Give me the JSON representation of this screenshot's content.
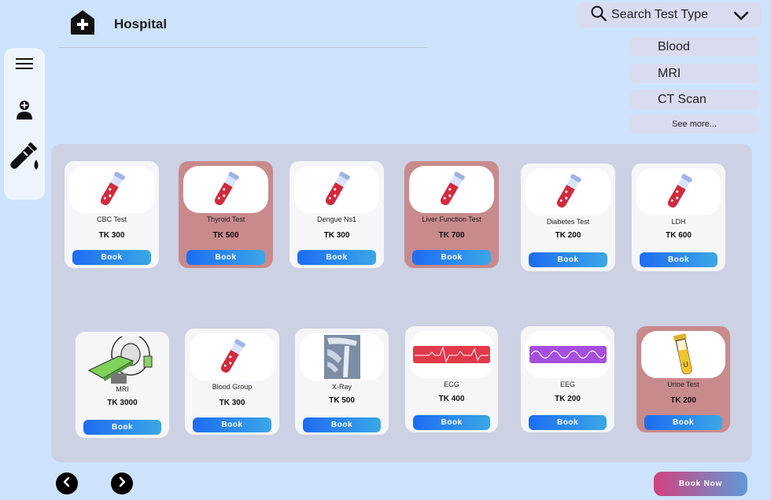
{
  "header": {
    "title": "Hospital"
  },
  "search": {
    "label": "Search Test Type",
    "options": [
      "Blood",
      "MRI",
      "CT Scan"
    ],
    "see_more": "See more..."
  },
  "tests": [
    {
      "name": "CBC Test",
      "price": "TK 300",
      "book": "Book",
      "icon": "test-tube-icon",
      "highlight": false
    },
    {
      "name": "Thyroid  Test",
      "price": "TK 500",
      "book": "Book",
      "icon": "test-tube-icon",
      "highlight": true
    },
    {
      "name": "Dengue Ns1",
      "price": "TK 300",
      "book": "Book",
      "icon": "test-tube-icon",
      "highlight": false
    },
    {
      "name": "Liver Function Test",
      "price": "TK 700",
      "book": "Book",
      "icon": "test-tube-icon",
      "highlight": true
    },
    {
      "name": "Diabetes Test",
      "price": "TK 200",
      "book": "Book",
      "icon": "test-tube-icon",
      "highlight": false
    },
    {
      "name": "LDH",
      "price": "TK 600",
      "book": "Book",
      "icon": "test-tube-icon",
      "highlight": false
    },
    {
      "name": "MRI",
      "price": "TK 3000",
      "book": "Book",
      "icon": "mri-machine-icon",
      "highlight": false
    },
    {
      "name": "Blood Group",
      "price": "TK 300",
      "book": "Book",
      "icon": "test-tube-icon",
      "highlight": false
    },
    {
      "name": "X-Ray",
      "price": "TK 500",
      "book": "Book",
      "icon": "xray-image-icon",
      "highlight": false
    },
    {
      "name": "ECG",
      "price": "TK 400",
      "book": "Book",
      "icon": "ecg-wave-icon",
      "highlight": false
    },
    {
      "name": "EEG",
      "price": "TK 200",
      "book": "Book",
      "icon": "eeg-wave-icon",
      "highlight": false
    },
    {
      "name": "Urine Test",
      "price": "TK 200",
      "book": "Book",
      "icon": "urine-sample-icon",
      "highlight": true
    }
  ],
  "footer": {
    "book_now": "Book Now"
  }
}
